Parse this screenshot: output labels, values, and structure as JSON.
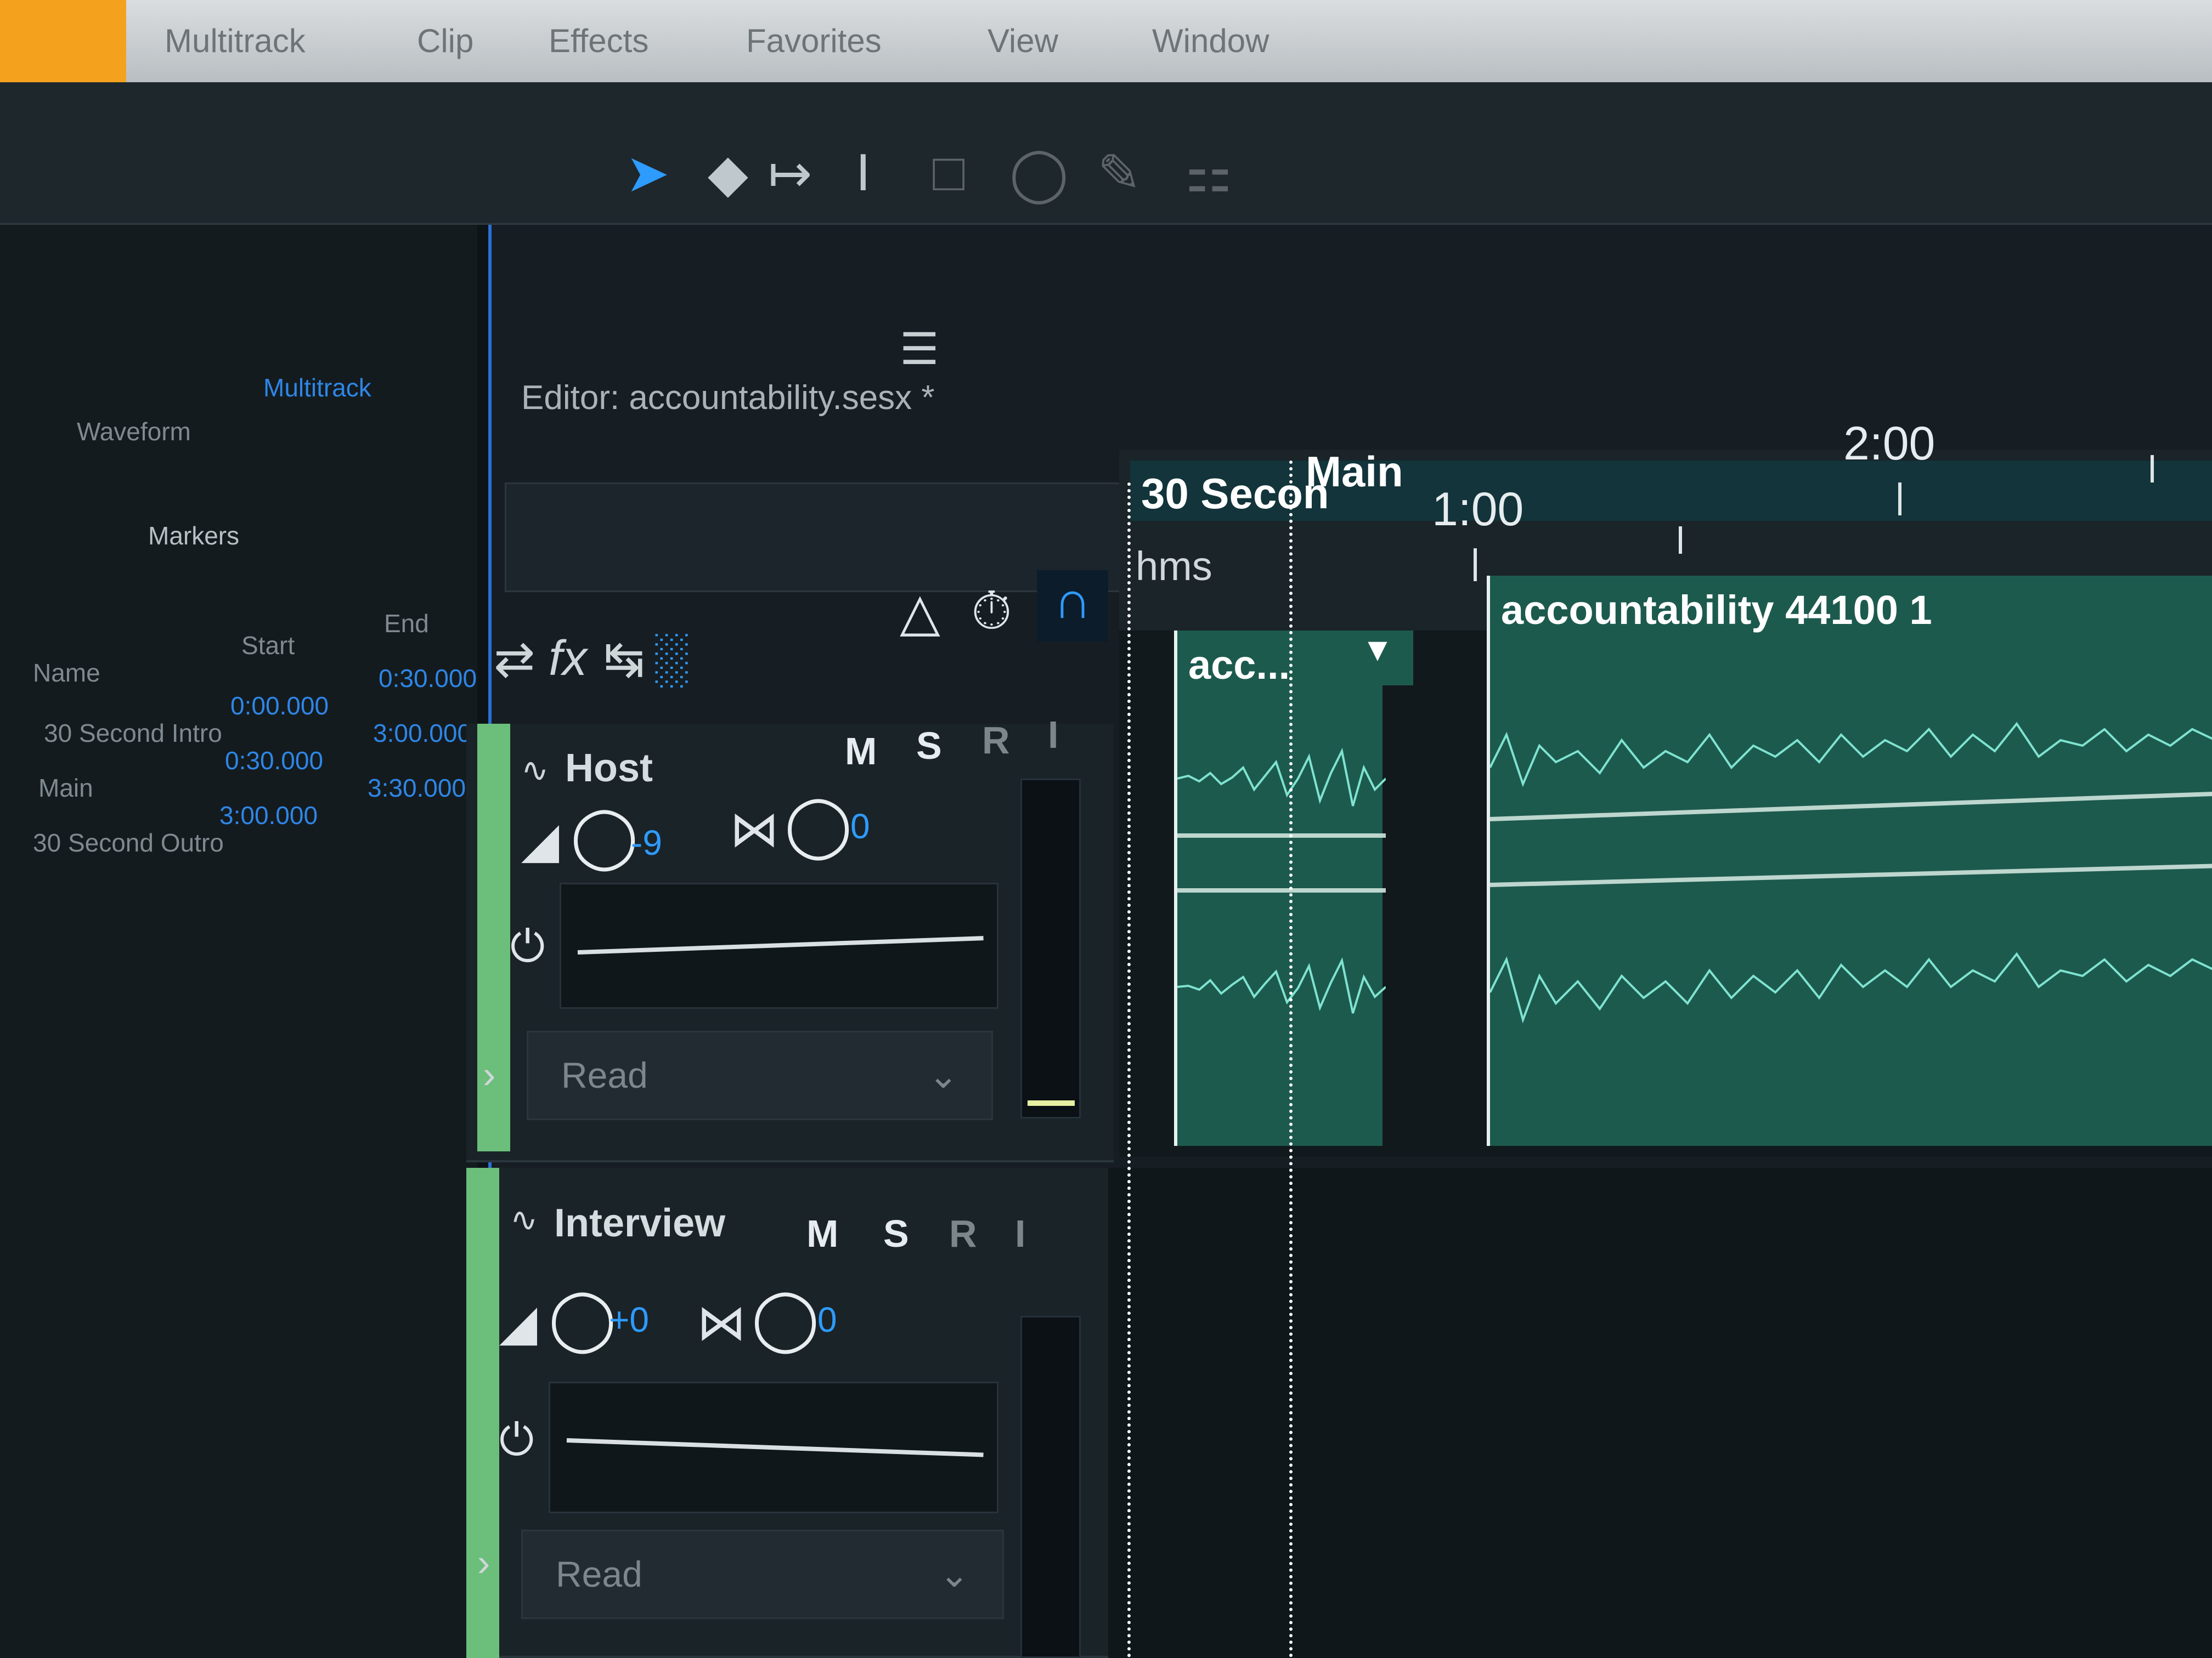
{
  "menu": {
    "items": [
      "Multitrack",
      "Clip",
      "Effects",
      "Favorites",
      "View",
      "Window"
    ]
  },
  "toolbar": {
    "tools": [
      "move-tool-icon",
      "razor-tool-icon",
      "slip-tool-icon",
      "time-selection-icon",
      "marquee-icon",
      "lasso-icon",
      "brush-icon",
      "spot-healing-icon"
    ]
  },
  "left_panel": {
    "tabs": [
      "Waveform",
      "Multitrack"
    ],
    "panel_tab": "Markers",
    "columns": [
      "Name",
      "Start",
      "End"
    ],
    "rows": [
      {
        "name": "30 Second Intro",
        "start": "0:00.000",
        "end": "0:30.000"
      },
      {
        "name": "Main",
        "start": "0:30.000",
        "end": "3:00.000"
      },
      {
        "name": "30 Second Outro",
        "start": "3:00.000",
        "end": "3:30.000"
      }
    ]
  },
  "editor": {
    "title": "Editor: accountability.sesx *"
  },
  "tracks": [
    {
      "name": "Host",
      "mute": "M",
      "solo": "S",
      "arm": "R",
      "input": "I",
      "volume": "-9",
      "pan": "0",
      "automation": "Read"
    },
    {
      "name": "Interview",
      "mute": "M",
      "solo": "S",
      "arm": "R",
      "input": "I",
      "volume": "+0",
      "pan": "0",
      "automation": "Read"
    }
  ],
  "timeline": {
    "time_format": "hms",
    "ruler_labels": [
      "1:00",
      "2:00"
    ],
    "markers": [
      "30 Secon",
      "Main"
    ],
    "clips": [
      {
        "title": "acc..."
      },
      {
        "title": "accountability 44100 1"
      }
    ]
  },
  "colors": {
    "accent": "#2e9bff",
    "clip": "#1d5a4e",
    "waveform": "#7fe3d0",
    "track_strip": "#6bbf7a",
    "menu_orange": "#f4a21e"
  }
}
